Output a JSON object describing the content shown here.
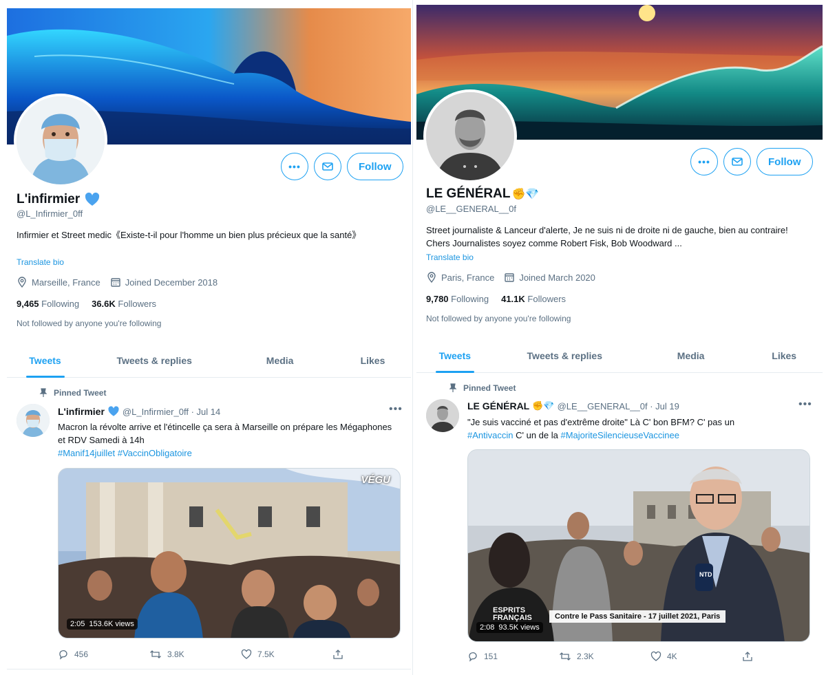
{
  "profiles": [
    {
      "display_name": "L'infirmier",
      "handle": "@L_Infirmier_0ff",
      "bio": "Infirmier et Street medic《Existe-t-il pour l'homme un bien plus précieux que la santé》",
      "translate_label": "Translate bio",
      "location": "Marseille, France",
      "joined": "Joined December 2018",
      "following_count": "9,465",
      "following_label": "Following",
      "followers_count": "36.6K",
      "followers_label": "Followers",
      "not_followed": "Not followed by anyone you're following",
      "follow_label": "Follow",
      "tabs": [
        "Tweets",
        "Tweets & replies",
        "Media",
        "Likes"
      ],
      "pinned_label": "Pinned Tweet",
      "tweet": {
        "name": "L'infirmier",
        "handle_date": "@L_Infirmier_0ff · Jul 14",
        "text": "Macron la révolte arrive et l'étincelle ça sera à Marseille on prépare les Mégaphones et RDV Samedi à 14h",
        "hashtags": "#Manif14juillet #VaccinObligatoire",
        "video_duration": "2:05",
        "video_views": "153.6K views",
        "watermark": "VÉGU",
        "replies": "456",
        "retweets": "3.8K",
        "likes": "7.5K"
      }
    },
    {
      "display_name": "LE GÉNÉRAL",
      "name_emoji": "✊💎",
      "handle": "@LE__GENERAL__0f",
      "bio": "Street journaliste & Lanceur d'alerte, Je ne suis ni de droite ni de gauche, bien au contraire! Chers Journalistes soyez comme Robert Fisk, Bob Woodward ...",
      "translate_label": "Translate bio",
      "location": "Paris, France",
      "joined": "Joined March 2020",
      "following_count": "9,780",
      "following_label": "Following",
      "followers_count": "41.1K",
      "followers_label": "Followers",
      "not_followed": "Not followed by anyone you're following",
      "follow_label": "Follow",
      "tabs": [
        "Tweets",
        "Tweets & replies",
        "Media",
        "Likes"
      ],
      "pinned_label": "Pinned Tweet",
      "tweet": {
        "name": "LE GÉNÉRAL",
        "name_emoji": "✊💎",
        "handle_date": "@LE__GENERAL__0f · Jul 19",
        "text_part1": "\"Je suis vacciné et pas d'extrême droite\" Là C' bon BFM? C' pas un",
        "hashtag1": "#Antivaccin",
        "text_part2": "C' un de la",
        "hashtag2": "#MajoriteSilencieuseVaccinee",
        "video_duration": "2:08",
        "video_views": "93.5K views",
        "caption_logo": "ESPRITS FRANÇAIS",
        "caption": "Contre le Pass Sanitaire - 17 juillet 2021, Paris",
        "mic_logo": "NTD",
        "replies": "151",
        "retweets": "2.3K",
        "likes": "4K"
      }
    }
  ],
  "colors": {
    "accent": "#1da1f2",
    "secondary_text": "#5b7083",
    "link": "#1b95e0",
    "verified": "#4aa3ef"
  },
  "icons": [
    "more-icon",
    "mail-icon",
    "location-icon",
    "calendar-icon",
    "pin-icon",
    "reply-icon",
    "retweet-icon",
    "like-icon",
    "share-icon",
    "verified-icon",
    "diamond-icon"
  ]
}
